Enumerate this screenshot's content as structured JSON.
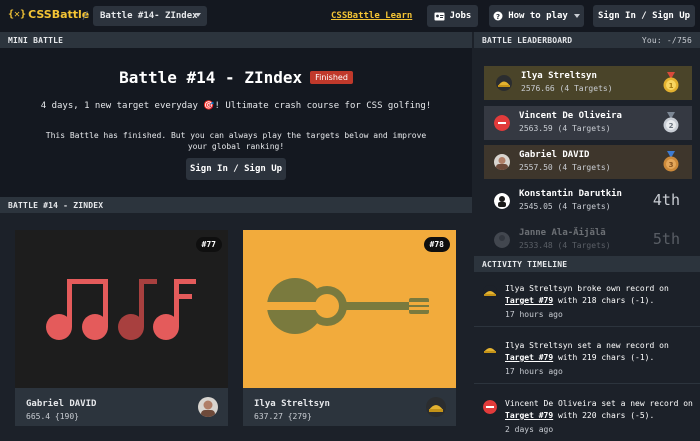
{
  "nav": {
    "logo_mark": "{✕}",
    "logo_text": "CSSBattle",
    "separator": "/",
    "battle_select": "Battle #14- ZIndex",
    "learn_link": "CSSBattle Learn",
    "jobs_label": "Jobs",
    "howto_label": "How to play",
    "signin_label": "Sign In / Sign Up"
  },
  "mini_battle": {
    "header": "MINI BATTLE",
    "title": "Battle #14 - ZIndex",
    "status": "Finished",
    "description": "4 days, 1 new target everyday 🎯! Ultimate crash course for CSS golfing!",
    "finished_text": "This Battle has finished. But you can always play the targets below and improve your global ranking!",
    "signin_label": "Sign In / Sign Up"
  },
  "battle_section": {
    "header": "BATTLE #14 - ZINDEX",
    "cards": [
      {
        "number": "#77",
        "user": "Gabriel DAVID",
        "score": "665.4 {190}",
        "art_bg": "#1d1d1d",
        "art_color": "#e45b5b"
      },
      {
        "number": "#78",
        "user": "Ilya Streltsyn",
        "score": "637.27 {279}",
        "art_bg": "#f2ab3c",
        "art_color": "#7a7a3e"
      }
    ]
  },
  "leaderboard": {
    "header": "BATTLE LEADERBOARD",
    "you": "You: -/756",
    "rows": [
      {
        "name": "Ilya Streltsyn",
        "score": "2576.66 (4 Targets)",
        "medal": "gold-medal"
      },
      {
        "name": "Vincent De Oliveira",
        "score": "2563.59 (4 Targets)",
        "medal": "silver-medal"
      },
      {
        "name": "Gabriel DAVID",
        "score": "2557.50 (4 Targets)",
        "medal": "bronze-medal"
      },
      {
        "name": "Konstantin Darutkin",
        "score": "2545.05 (4 Targets)",
        "rank": "4th"
      },
      {
        "name": "Janne Ala-Äijälä",
        "score": "2533.48 (4 Targets)",
        "rank": "5th"
      }
    ]
  },
  "activity": {
    "header": "ACTIVITY TIMELINE",
    "items": [
      {
        "prefix": "Ilya Streltsyn broke own record on ",
        "target": "Target #79",
        "suffix": " with 218 chars (-1).",
        "time": "17 hours ago"
      },
      {
        "prefix": "Ilya Streltsyn set a new record on ",
        "target": "Target #79",
        "suffix": " with 219 chars (-1).",
        "time": "17 hours ago"
      },
      {
        "prefix": "Vincent De Oliveira set a new record on ",
        "target": "Target #79",
        "suffix": " with 220 chars (-5).",
        "time": "2 days ago"
      }
    ]
  },
  "colors": {
    "accent": "#f4c435",
    "finished": "#c0392b",
    "gold_row": "#4a4429",
    "bronze_row": "#3e362c"
  }
}
